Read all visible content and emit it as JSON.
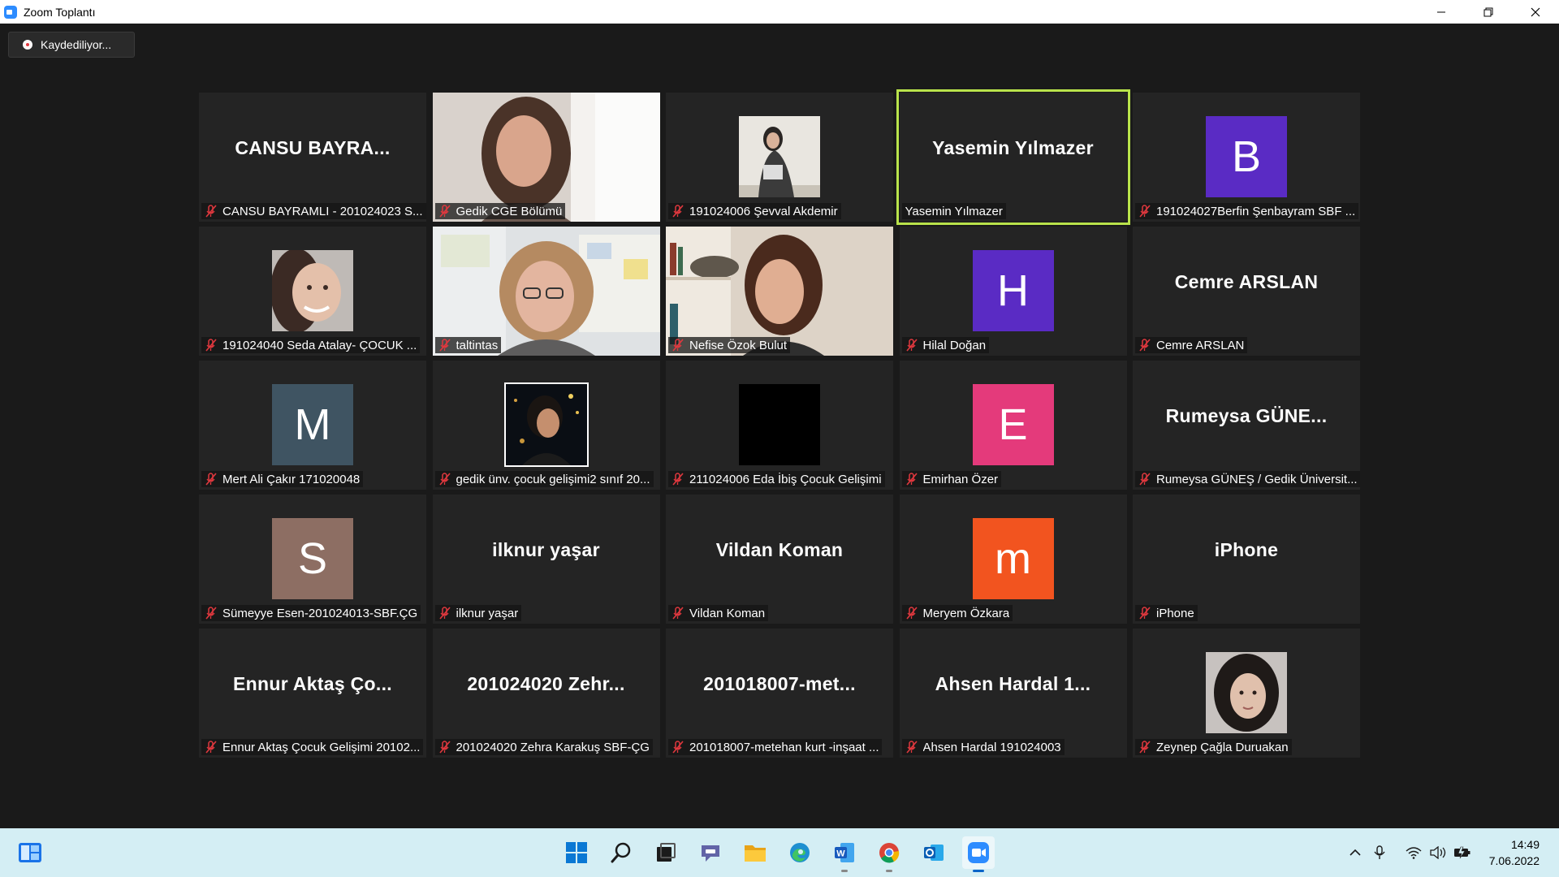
{
  "window": {
    "title": "Zoom Toplantı"
  },
  "recording": {
    "label": "Kaydediliyor..."
  },
  "tiles": [
    {
      "kind": "text",
      "big": "CANSU  BAYRA...",
      "name": "CANSU BAYRAMLI - 201024023 S..."
    },
    {
      "kind": "video",
      "scene": "woman-window",
      "name": "Gedik CGE Bölümü"
    },
    {
      "kind": "photo",
      "scene": "woman-wall",
      "name": "191024006 Şevval Akdemir"
    },
    {
      "kind": "text",
      "big": "Yasemin Yılmazer",
      "name": "Yasemin Yılmazer",
      "active": true
    },
    {
      "kind": "avatar",
      "letter": "B",
      "color": "#5a2bc4",
      "name": "191024027Berfin Şenbayram SBF ..."
    },
    {
      "kind": "photo",
      "scene": "smiling-face",
      "name": "191024040 Seda Atalay- ÇOCUK ..."
    },
    {
      "kind": "video",
      "scene": "woman-glasses",
      "name": "taltintas"
    },
    {
      "kind": "video",
      "scene": "woman-shelf",
      "name": "Nefise Özok Bulut"
    },
    {
      "kind": "avatar",
      "letter": "H",
      "color": "#5a2bc4",
      "name": "Hilal Doğan"
    },
    {
      "kind": "text",
      "big": "Cemre ARSLAN",
      "name": "Cemre ARSLAN"
    },
    {
      "kind": "avatar",
      "letter": "M",
      "color": "#3f5462",
      "name": "Mert Ali Çakır 171020048"
    },
    {
      "kind": "photo",
      "scene": "night-portrait",
      "framed": true,
      "name": "gedik ünv. çocuk gelişimi2 sınıf 20..."
    },
    {
      "kind": "photo",
      "scene": "black",
      "name": "211024006 Eda İbiş Çocuk Gelişimi"
    },
    {
      "kind": "avatar",
      "letter": "E",
      "color": "#e43a7b",
      "name": "Emirhan Özer"
    },
    {
      "kind": "text",
      "big": "Rumeysa  GÜNE...",
      "name": "Rumeysa GÜNEŞ / Gedik Üniversit..."
    },
    {
      "kind": "avatar",
      "letter": "S",
      "color": "#8d6e63",
      "name": "Sümeyye Esen-201024013-SBF.ÇG"
    },
    {
      "kind": "text",
      "big": "ilknur yaşar",
      "name": "ilknur yaşar"
    },
    {
      "kind": "text",
      "big": "Vildan Koman",
      "name": "Vildan Koman"
    },
    {
      "kind": "avatar",
      "letter": "m",
      "color": "#f2541f",
      "name": "Meryem Özkara"
    },
    {
      "kind": "text",
      "big": "iPhone",
      "name": "iPhone"
    },
    {
      "kind": "text",
      "big": "Ennur Aktaş Ço...",
      "name": "Ennur Aktaş Çocuk Gelişimi 20102..."
    },
    {
      "kind": "text",
      "big": "201024020  Zehr...",
      "name": "201024020 Zehra Karakuş SBF-ÇG"
    },
    {
      "kind": "text",
      "big": "201018007-met...",
      "name": "201018007-metehan kurt -inşaat ..."
    },
    {
      "kind": "text",
      "big": "Ahsen  Hardal  1...",
      "name": "Ahsen Hardal 191024003"
    },
    {
      "kind": "photo",
      "scene": "woman-curly",
      "name": "Zeynep Çağla Duruakan"
    }
  ],
  "taskbar": {
    "apps": [
      "start",
      "search",
      "task-view",
      "teams",
      "file-explorer",
      "edge",
      "word",
      "chrome",
      "outlook",
      "zoom"
    ],
    "active_app": "zoom",
    "time": "14:49",
    "date": "7.06.2022"
  }
}
